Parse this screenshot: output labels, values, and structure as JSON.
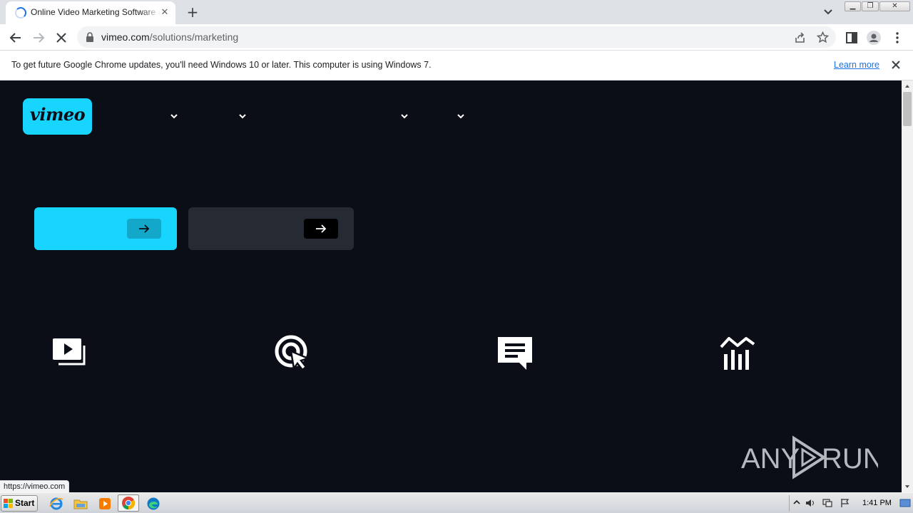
{
  "browser": {
    "tab": {
      "title": "Online Video Marketing Software and Tools | Vimeo",
      "loading": true
    },
    "address_bar": {
      "host": "vimeo.com",
      "path": "/solutions/marketing"
    },
    "infobar": {
      "message": "To get future Google Chrome updates, you'll need Windows 10 or later. This computer is using Windows 7.",
      "link_label": "Learn more"
    },
    "status_url": "https://vimeo.com"
  },
  "page": {
    "logo_text": "vimeo",
    "nav_dropdowns": [
      "chevron-down-icon",
      "chevron-down-icon",
      "chevron-down-icon",
      "chevron-down-icon"
    ],
    "feature_icons": [
      "video-library-icon",
      "target-cursor-icon",
      "chat-message-icon",
      "analytics-chart-icon"
    ],
    "watermark_text": "ANY RUN",
    "colors": {
      "accent": "#17d5ff",
      "background": "#0b0e16",
      "secondary_button": "#252a33"
    }
  },
  "taskbar": {
    "start_label": "Start",
    "apps": [
      "internet-explorer-icon",
      "file-explorer-icon",
      "media-player-icon",
      "chrome-icon",
      "edge-icon"
    ],
    "clock": "1:41 PM"
  }
}
